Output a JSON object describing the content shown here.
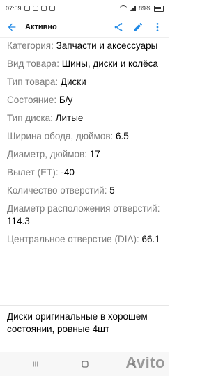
{
  "status_bar": {
    "time": "07:59",
    "battery": "89%",
    "icons": [
      "email-icon",
      "image-icon",
      "alarm-icon",
      "settings-icon",
      "wifi-icon",
      "signal-icon",
      "battery-icon"
    ]
  },
  "appbar": {
    "title": "Активно",
    "icons": [
      "back-arrow-icon",
      "share-icon",
      "edit-icon",
      "more-icon"
    ]
  },
  "details": [
    {
      "k": "Категория: ",
      "v": "Запчасти и аксессуары"
    },
    {
      "k": "Вид товара: ",
      "v": "Шины, диски и колёса"
    },
    {
      "k": "Тип товара: ",
      "v": "Диски"
    },
    {
      "k": "Состояние: ",
      "v": "Б/у"
    },
    {
      "k": "Тип диска: ",
      "v": "Литые"
    },
    {
      "k": "Ширина обода, дюймов: ",
      "v": "6.5"
    },
    {
      "k": "Диаметр, дюймов: ",
      "v": "17"
    },
    {
      "k": "Вылет (ET): ",
      "v": "-40"
    },
    {
      "k": "Количество отверстий: ",
      "v": "5"
    },
    {
      "k": "Диаметр расположения отверстий: ",
      "v": "114.3"
    },
    {
      "k": "Центральное отверстие (DIA): ",
      "v": "66.1"
    }
  ],
  "description": "Диски оригинальные в хорошем состоянии, ровные 4шт",
  "navbar": {
    "icons": [
      "recent-apps-icon",
      "home-icon",
      "back-icon"
    ]
  },
  "watermark": "Avito"
}
